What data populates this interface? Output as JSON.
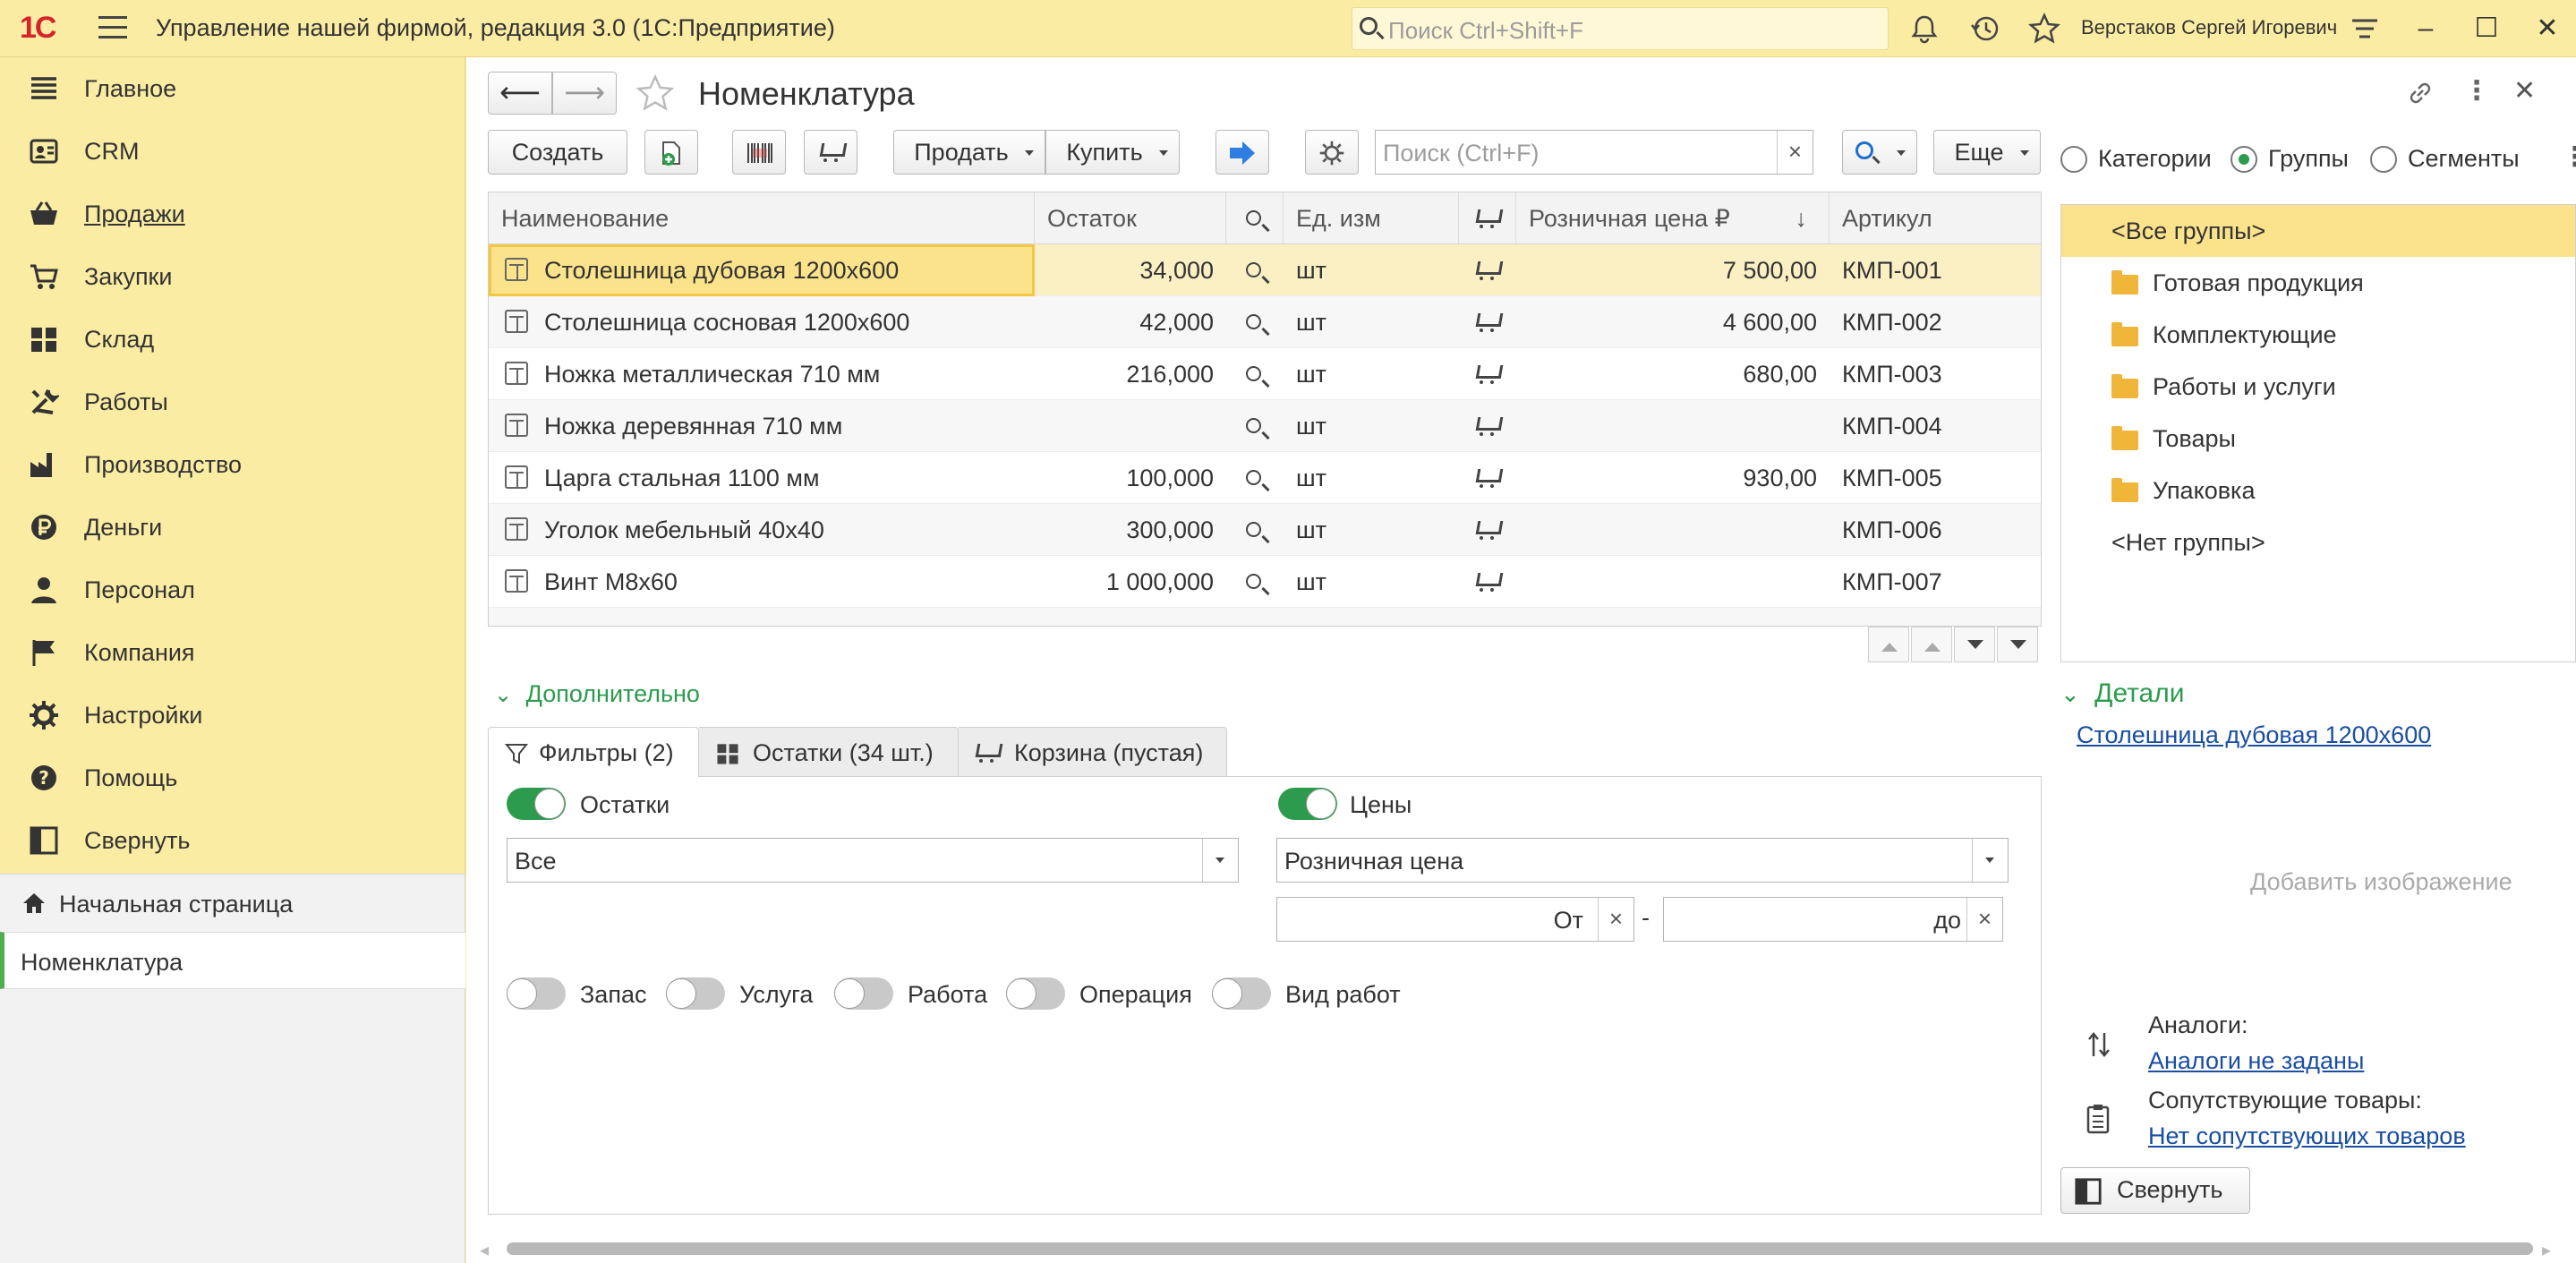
{
  "titlebar": {
    "logo": "1С",
    "app_title": "Управление нашей фирмой, редакция 3.0  (1С:Предприятие)",
    "search_placeholder": "Поиск Ctrl+Shift+F",
    "user": "Верстаков Сергей Игоревич"
  },
  "sidebar": {
    "items": [
      {
        "label": "Главное",
        "icon": "menu-lines-icon"
      },
      {
        "label": "CRM",
        "icon": "contacts-icon"
      },
      {
        "label": "Продажи",
        "icon": "basket-icon"
      },
      {
        "label": "Закупки",
        "icon": "cart-icon"
      },
      {
        "label": "Склад",
        "icon": "warehouse-grid-icon"
      },
      {
        "label": "Работы",
        "icon": "tools-icon"
      },
      {
        "label": "Производство",
        "icon": "factory-icon"
      },
      {
        "label": "Деньги",
        "icon": "ruble-coin-icon"
      },
      {
        "label": "Персонал",
        "icon": "person-icon"
      },
      {
        "label": "Компания",
        "icon": "flag-icon"
      },
      {
        "label": "Настройки",
        "icon": "gear-icon"
      },
      {
        "label": "Помощь",
        "icon": "help-icon"
      },
      {
        "label": "Свернуть",
        "icon": "collapse-panel-icon"
      }
    ],
    "opened": [
      {
        "label": "Начальная страница",
        "icon": "home-icon"
      },
      {
        "label": "Номенклатура"
      }
    ]
  },
  "main": {
    "title": "Номенклатура",
    "toolbar": {
      "create": "Создать",
      "sell": "Продать",
      "buy": "Купить",
      "search_placeholder": "Поиск (Ctrl+F)",
      "clear": "×",
      "more": "Еще"
    },
    "table": {
      "columns": [
        "Наименование",
        "Остаток",
        "Ед. изм",
        "Розничная цена ₽",
        "Артикул"
      ],
      "sort_indicator": "↓",
      "rows": [
        {
          "name": "Столешница дубовая 1200х600",
          "stock": "34,000",
          "unit": "шт",
          "price": "7 500,00",
          "sku": "КМП-001"
        },
        {
          "name": "Столешница сосновая 1200х600",
          "stock": "42,000",
          "unit": "шт",
          "price": "4 600,00",
          "sku": "КМП-002"
        },
        {
          "name": "Ножка металлическая 710 мм",
          "stock": "216,000",
          "unit": "шт",
          "price": "680,00",
          "sku": "КМП-003"
        },
        {
          "name": "Ножка деревянная 710 мм",
          "stock": "",
          "unit": "шт",
          "price": "",
          "sku": "КМП-004"
        },
        {
          "name": "Царга стальная 1100 мм",
          "stock": "100,000",
          "unit": "шт",
          "price": "930,00",
          "sku": "КМП-005"
        },
        {
          "name": "Уголок мебельный 40х40",
          "stock": "300,000",
          "unit": "шт",
          "price": "",
          "sku": "КМП-006"
        },
        {
          "name": "Винт М8х60",
          "stock": "1 000,000",
          "unit": "шт",
          "price": "",
          "sku": "КМП-007"
        }
      ]
    },
    "radio": {
      "categories": "Категории",
      "groups": "Группы",
      "segments": "Сегменты"
    },
    "groups": [
      "<Все группы>",
      "Готовая продукция",
      "Комплектующие",
      "Работы и услуги",
      "Товары",
      "Упаковка",
      "<Нет группы>"
    ],
    "additional": {
      "title": "Дополнительно",
      "tabs": [
        "Фильтры (2)",
        "Остатки (34 шт.)",
        "Корзина (пустая)"
      ],
      "filters": {
        "stock_toggle": "Остатки",
        "stock_value": "Все",
        "price_toggle": "Цены",
        "price_type": "Розничная цена",
        "from": "От",
        "dash": "-",
        "to": "до",
        "clear": "×",
        "types": [
          "Запас",
          "Услуга",
          "Работа",
          "Операция",
          "Вид работ"
        ]
      }
    },
    "details": {
      "title": "Детали",
      "item_link": "Столешница дубовая 1200х600",
      "add_image": "Добавить изображение",
      "analogs_label": "Аналоги:",
      "analogs_link": "Аналоги не заданы",
      "related_label": "Сопутствующие товары:",
      "related_link": "Нет сопутствующих товаров",
      "collapse": "Свернуть"
    }
  }
}
